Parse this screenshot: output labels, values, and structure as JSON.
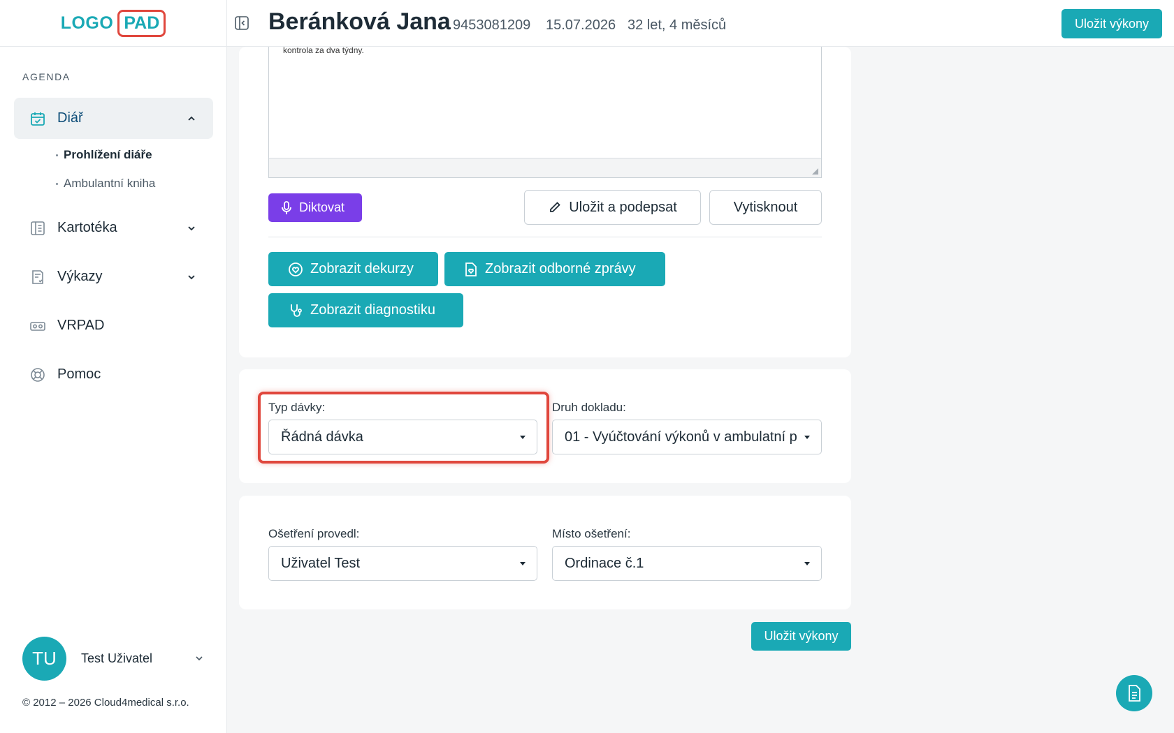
{
  "logo": {
    "left": "LOGO",
    "right": "PAD"
  },
  "sidebar": {
    "section_title": "AGENDA",
    "items": [
      {
        "label": "Diář",
        "icon": "calendar-icon"
      },
      {
        "label": "Kartotéka",
        "icon": "book-icon"
      },
      {
        "label": "Výkazy",
        "icon": "report-icon"
      },
      {
        "label": "VRPAD",
        "icon": "vr-icon"
      },
      {
        "label": "Pomoc",
        "icon": "lifebuoy-icon"
      }
    ],
    "subitems": [
      {
        "label": "Prohlížení diáře"
      },
      {
        "label": "Ambulantní kniha"
      }
    ],
    "user": {
      "initials": "TU",
      "name": "Test Uživatel"
    },
    "copyright": "© 2012 – 2026 Cloud4medical s.r.o."
  },
  "header": {
    "patient_name": "Beránková Jana",
    "patient_id": "9453081209",
    "date": "15.07.2026",
    "age": "32 let, 4 měsíců",
    "save_label": "Uložit výkony"
  },
  "editor": {
    "text": "kontrola za dva týdny."
  },
  "buttons": {
    "dictate": "Diktovat",
    "save_sign": "Uložit a podepsat",
    "print": "Vytisknout",
    "show_decurses": "Zobrazit dekurzy",
    "show_reports": "Zobrazit odborné zprávy",
    "show_diagnostics": "Zobrazit diagnostiku",
    "save_bottom": "Uložit výkony"
  },
  "batch": {
    "type_label": "Typ dávky:",
    "type_value": "Řádná dávka",
    "doc_label": "Druh dokladu:",
    "doc_value": "01 - Vyúčtování výkonů v ambulatní p"
  },
  "treatment": {
    "by_label": "Ošetření provedl:",
    "by_value": "Uživatel Test",
    "place_label": "Místo ošetření:",
    "place_value": "Ordinace č.1"
  },
  "colors": {
    "accent": "#1aa9b5",
    "purple": "#7a3ee8",
    "highlight": "#e0473d",
    "text": "#1d2b36"
  }
}
